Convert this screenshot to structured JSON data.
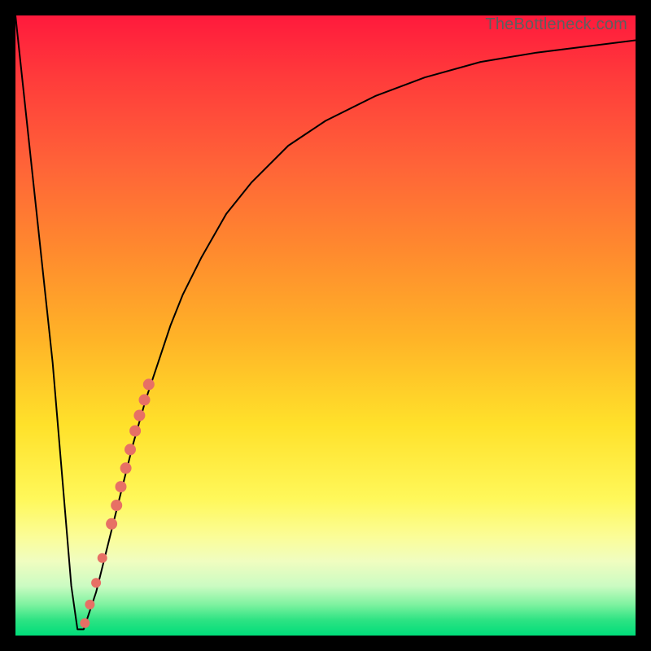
{
  "watermark": "TheBottleneck.com",
  "chart_data": {
    "type": "line",
    "title": "",
    "xlabel": "",
    "ylabel": "",
    "xlim": [
      0,
      100
    ],
    "ylim": [
      0,
      100
    ],
    "series": [
      {
        "name": "bottleneck-curve",
        "x": [
          0,
          6,
          8,
          9,
          10,
          11,
          13,
          15,
          17,
          19,
          21,
          23,
          25,
          27,
          30,
          34,
          38,
          44,
          50,
          58,
          66,
          75,
          84,
          92,
          100
        ],
        "y": [
          100,
          44,
          20,
          8,
          1,
          1,
          7,
          15,
          23,
          31,
          38,
          44,
          50,
          55,
          61,
          68,
          73,
          79,
          83,
          87,
          90,
          92.5,
          94,
          95,
          96
        ]
      }
    ],
    "markers": {
      "name": "highlighted-range",
      "color": "#e77065",
      "points": [
        {
          "x": 11.2,
          "y": 2.0,
          "r": 6
        },
        {
          "x": 12.0,
          "y": 5.0,
          "r": 6
        },
        {
          "x": 13.0,
          "y": 8.5,
          "r": 6
        },
        {
          "x": 14.0,
          "y": 12.5,
          "r": 6
        },
        {
          "x": 15.5,
          "y": 18.0,
          "r": 7
        },
        {
          "x": 16.3,
          "y": 21.0,
          "r": 7
        },
        {
          "x": 17.0,
          "y": 24.0,
          "r": 7
        },
        {
          "x": 17.8,
          "y": 27.0,
          "r": 7
        },
        {
          "x": 18.5,
          "y": 30.0,
          "r": 7
        },
        {
          "x": 19.3,
          "y": 33.0,
          "r": 7
        },
        {
          "x": 20.0,
          "y": 35.5,
          "r": 7
        },
        {
          "x": 20.8,
          "y": 38.0,
          "r": 7
        },
        {
          "x": 21.5,
          "y": 40.5,
          "r": 7
        }
      ]
    },
    "background": "rainbow-vertical-gradient"
  }
}
